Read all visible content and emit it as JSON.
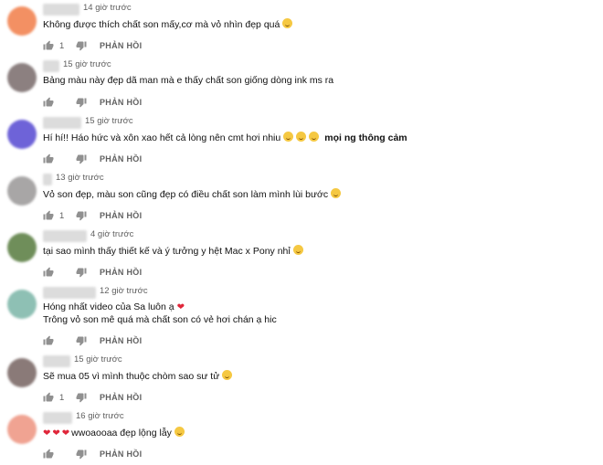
{
  "reply_label": "PHẢN HỒI",
  "colors": {
    "accent_heart": "#e0263a",
    "meta": "#606060"
  },
  "icons": {
    "like": "thumb-up-icon",
    "dislike": "thumb-down-icon"
  },
  "comments": [
    {
      "avatar_color": "#f39063",
      "time": "14 giờ trước",
      "lines": [
        "Không được thích chất son mấy,cơ mà vỏ nhìn đẹp quá"
      ],
      "likes": "1"
    },
    {
      "avatar_color": "#8c8080",
      "time": "15 giờ trước",
      "lines": [
        "Bảng màu này đẹp dã man mà e thấy chất son giống dòng ink ms ra"
      ],
      "likes": ""
    },
    {
      "avatar_color": "#6e63d8",
      "time": "15 giờ trước",
      "lines": [
        "Hí hí!! Háo hức và xôn xao hết cả lòng nên cmt hơi nhiu"
      ],
      "extra": "mọi ng thông cảm",
      "likes": ""
    },
    {
      "avatar_color": "#a8a6a6",
      "time": "13 giờ trước",
      "lines": [
        "Vỏ son đẹp, màu son cũng đẹp có điều chất son làm mình lùi bước"
      ],
      "likes": "1"
    },
    {
      "avatar_color": "#6f8e5a",
      "time": "4 giờ trước",
      "lines": [
        "tại sao mình thấy thiết kế và ý tưởng y hệt Mac x Pony nhỉ"
      ],
      "likes": ""
    },
    {
      "avatar_color": "#8ec0b4",
      "time": "12 giờ trước",
      "lines": [
        "Hóng nhất video của Sa luôn ạ",
        "Trông vỏ son mê quá mà chất son có vẻ hơi chán ạ hic"
      ],
      "likes": ""
    },
    {
      "avatar_color": "#8a7a78",
      "time": "15 giờ trước",
      "lines": [
        "Sẽ mua 05 vì mình thuộc chòm sao sư tử"
      ],
      "likes": "1"
    },
    {
      "avatar_color": "#f0a392",
      "time": "16 giờ trước",
      "lines": [
        "wwoaooaa   đẹp lộng lẫy"
      ],
      "likes": ""
    }
  ]
}
